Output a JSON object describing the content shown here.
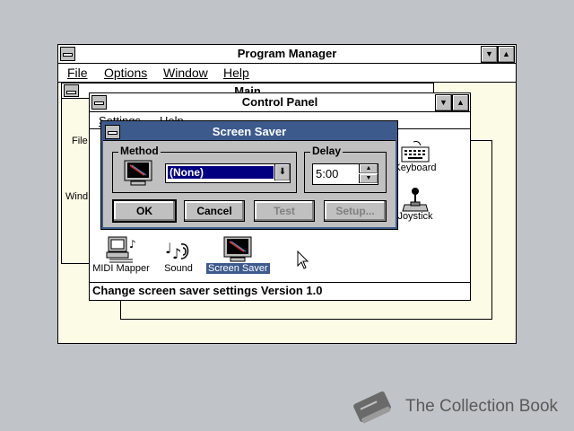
{
  "program_manager": {
    "title": "Program Manager",
    "menu": {
      "file": "File",
      "options": "Options",
      "window": "Window",
      "help": "Help"
    },
    "main_title": "Main",
    "left_partial_labels": [
      "File",
      "Wind"
    ]
  },
  "control_panel": {
    "title": "Control Panel",
    "menu": {
      "settings": "Settings",
      "help": "Help"
    },
    "icons": [
      {
        "label": "MIDI Mapper"
      },
      {
        "label": "Sound"
      },
      {
        "label": "Screen Saver"
      },
      {
        "label": "Keyboard"
      },
      {
        "label": "Joystick"
      }
    ],
    "status": "Change screen saver settings Version 1.0"
  },
  "screen_saver": {
    "title": "Screen Saver",
    "method_label": "Method",
    "method_value": "(None)",
    "delay_label": "Delay",
    "delay_value": "5:00",
    "buttons": {
      "ok": "OK",
      "cancel": "Cancel",
      "test": "Test",
      "setup": "Setup..."
    }
  },
  "watermark": {
    "text": "The Collection Book"
  },
  "colors": {
    "active_title": "#3c5a8c",
    "desktop": "#c0c4c8",
    "group_bg": "#fbfbe6"
  }
}
